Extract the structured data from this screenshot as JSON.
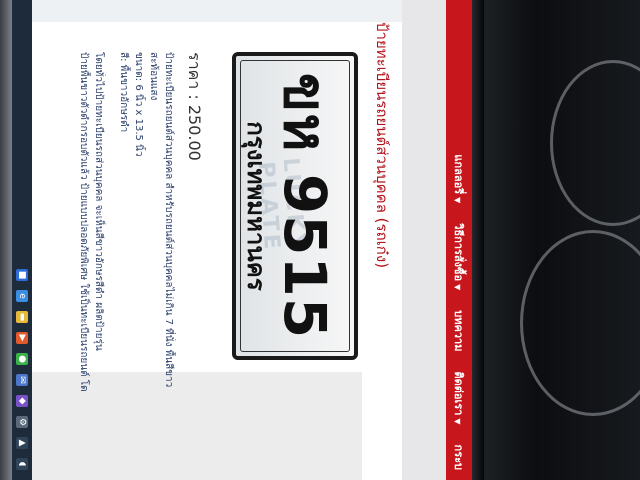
{
  "nav": {
    "items": [
      {
        "label": "กระบ",
        "caret": ""
      },
      {
        "label": "ติดต่อเรา",
        "caret": "▼"
      },
      {
        "label": "บทความ",
        "caret": ""
      },
      {
        "label": "วิธีการสั่งซื้อ",
        "caret": "▼"
      },
      {
        "label": "แกลลอรี่",
        "caret": "▼"
      }
    ]
  },
  "product": {
    "title": "ป้ายทะเบียนรถยนต์ส่วนบุคคล (รถเก๋ง)",
    "plate_number": "ขห 9515",
    "plate_province": "กรุงเทพมหานคร",
    "watermark": "LUCKY PLATE",
    "price": "ราคา : 250.00"
  },
  "description": {
    "lines": [
      "ป้ายทะเบียนรถยนต์ส่วนบุคคล สำหรับรถยนต์ส่วนบุคคลไม่เกิน 7 ที่นั่ง พื้นสีขาว",
      "สะท้อนแสง",
      "ขนาด: 6 นิ้ว x 13.5 นิ้ว",
      "สี: พื้นขาวอักษรดำ"
    ],
    "note_lines": [
      "โดยทั่วไปป้ายทะเบียนรถส่วนบุคคล จะเห็นสีขาวอักษรสีดำ ผลิตป้ายรุ่น",
      "ป้ายพื้นขาวตัวดำกรอบตัวแล้ว ป้ายแบบปลอดภัยพิเศษ ใช้เป็นทะเบียนรถยนต์ โด"
    ]
  },
  "taskbar": {
    "icons": [
      "start-icon",
      "ie-icon",
      "folder-icon",
      "media-icon",
      "chrome-icon",
      "mail-icon",
      "app-icon",
      "settings-icon",
      "network-icon",
      "volume-icon"
    ]
  },
  "colors": {
    "nav_bg": "#c8161d",
    "title": "#b3131b",
    "text": "#2b3f6b"
  }
}
